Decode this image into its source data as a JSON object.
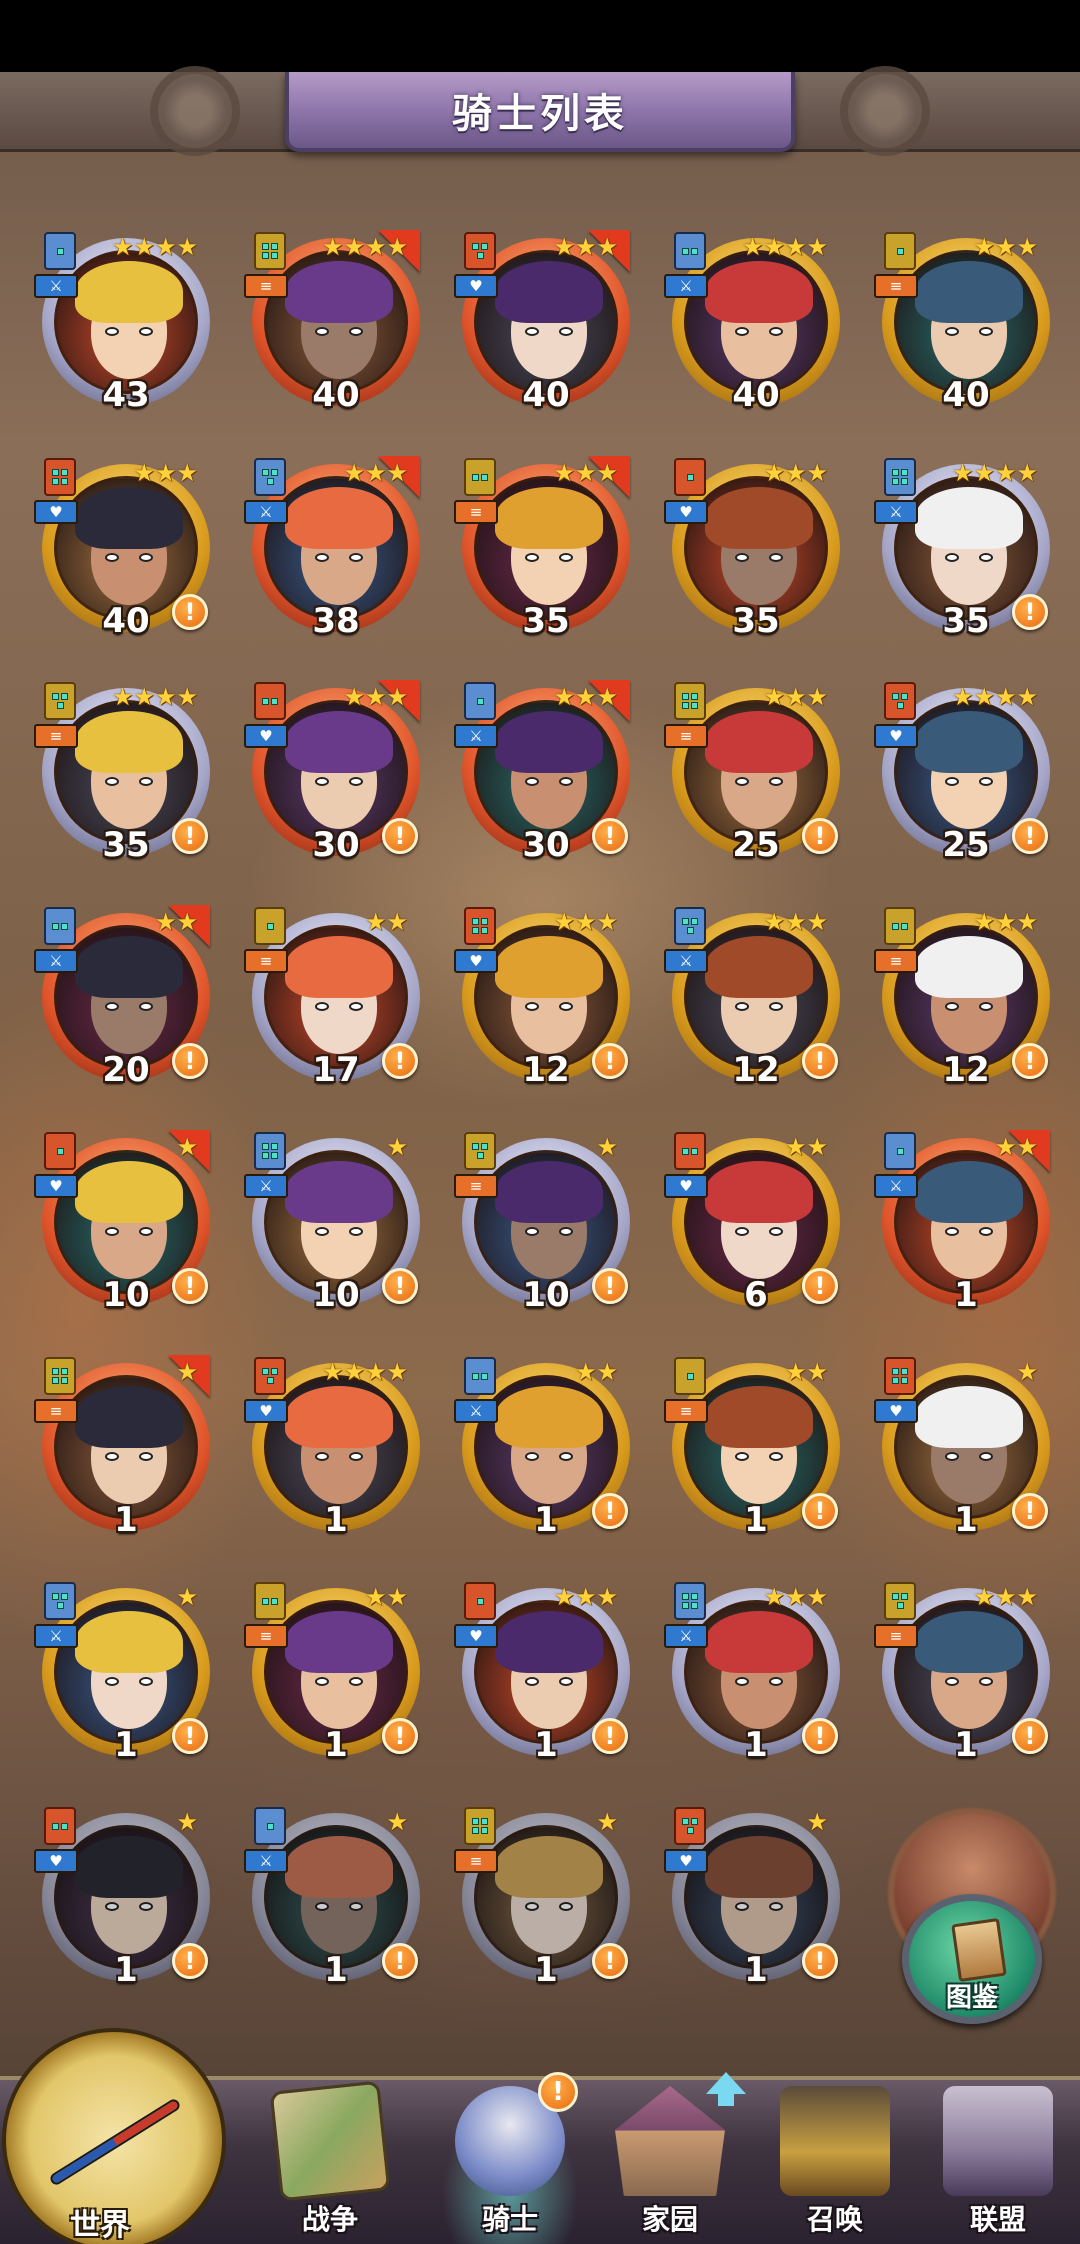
{
  "title": "骑士列表",
  "heroes": [
    {
      "level": "43",
      "stars": 4,
      "frame": "silver",
      "flag": false,
      "alert": false
    },
    {
      "level": "40",
      "stars": 4,
      "frame": "red",
      "flag": true,
      "alert": false
    },
    {
      "level": "40",
      "stars": 3,
      "frame": "red",
      "flag": true,
      "alert": false
    },
    {
      "level": "40",
      "stars": 4,
      "frame": "gold",
      "flag": false,
      "alert": false
    },
    {
      "level": "40",
      "stars": 3,
      "frame": "gold",
      "flag": false,
      "alert": false
    },
    {
      "level": "40",
      "stars": 3,
      "frame": "gold",
      "flag": false,
      "alert": true
    },
    {
      "level": "38",
      "stars": 3,
      "frame": "red",
      "flag": true,
      "alert": false
    },
    {
      "level": "35",
      "stars": 3,
      "frame": "red",
      "flag": true,
      "alert": false
    },
    {
      "level": "35",
      "stars": 3,
      "frame": "gold",
      "flag": false,
      "alert": false
    },
    {
      "level": "35",
      "stars": 4,
      "frame": "silver",
      "flag": false,
      "alert": true
    },
    {
      "level": "35",
      "stars": 4,
      "frame": "silver",
      "flag": false,
      "alert": true
    },
    {
      "level": "30",
      "stars": 3,
      "frame": "red",
      "flag": true,
      "alert": true
    },
    {
      "level": "30",
      "stars": 3,
      "frame": "red",
      "flag": true,
      "alert": true
    },
    {
      "level": "25",
      "stars": 3,
      "frame": "gold",
      "flag": false,
      "alert": true
    },
    {
      "level": "25",
      "stars": 4,
      "frame": "silver",
      "flag": false,
      "alert": true
    },
    {
      "level": "20",
      "stars": 2,
      "frame": "red",
      "flag": true,
      "alert": true
    },
    {
      "level": "17",
      "stars": 2,
      "frame": "silver",
      "flag": false,
      "alert": true
    },
    {
      "level": "12",
      "stars": 3,
      "frame": "gold",
      "flag": false,
      "alert": true
    },
    {
      "level": "12",
      "stars": 3,
      "frame": "gold",
      "flag": false,
      "alert": true
    },
    {
      "level": "12",
      "stars": 3,
      "frame": "gold",
      "flag": false,
      "alert": true
    },
    {
      "level": "10",
      "stars": 1,
      "frame": "red",
      "flag": true,
      "alert": true
    },
    {
      "level": "10",
      "stars": 1,
      "frame": "silver",
      "flag": false,
      "alert": true
    },
    {
      "level": "10",
      "stars": 1,
      "frame": "silver",
      "flag": false,
      "alert": true
    },
    {
      "level": "6",
      "stars": 2,
      "frame": "gold",
      "flag": false,
      "alert": true
    },
    {
      "level": "1",
      "stars": 2,
      "frame": "red",
      "flag": true,
      "alert": false
    },
    {
      "level": "1",
      "stars": 1,
      "frame": "red",
      "flag": true,
      "alert": false
    },
    {
      "level": "1",
      "stars": 4,
      "frame": "gold",
      "flag": false,
      "alert": false
    },
    {
      "level": "1",
      "stars": 2,
      "frame": "gold",
      "flag": false,
      "alert": true
    },
    {
      "level": "1",
      "stars": 2,
      "frame": "gold",
      "flag": false,
      "alert": true
    },
    {
      "level": "1",
      "stars": 1,
      "frame": "gold",
      "flag": false,
      "alert": true
    },
    {
      "level": "1",
      "stars": 1,
      "frame": "gold",
      "flag": false,
      "alert": true
    },
    {
      "level": "1",
      "stars": 2,
      "frame": "gold",
      "flag": false,
      "alert": true
    },
    {
      "level": "1",
      "stars": 3,
      "frame": "silver",
      "flag": false,
      "alert": true
    },
    {
      "level": "1",
      "stars": 3,
      "frame": "silver",
      "flag": false,
      "alert": true
    },
    {
      "level": "1",
      "stars": 3,
      "frame": "silver",
      "flag": false,
      "alert": true
    },
    {
      "level": "1",
      "stars": 1,
      "frame": "silver",
      "flag": false,
      "alert": true,
      "dim": true
    },
    {
      "level": "1",
      "stars": 1,
      "frame": "silver",
      "flag": false,
      "alert": true,
      "dim": true
    },
    {
      "level": "1",
      "stars": 1,
      "frame": "silver",
      "flag": false,
      "alert": true,
      "dim": true
    },
    {
      "level": "1",
      "stars": 1,
      "frame": "silver",
      "flag": false,
      "alert": true,
      "dim": true
    }
  ],
  "alert_symbol": "!",
  "codex_label": "图鉴",
  "nav": {
    "world": "世界",
    "war": "战争",
    "knight": "骑士",
    "home": "家园",
    "summon": "召唤",
    "alliance": "联盟",
    "knight_alert": "!"
  },
  "colors": {
    "gold_frame": "#d89a1c",
    "silver_frame": "#a6a7c8",
    "red_frame": "#e0542a",
    "alert": "#e86a10",
    "title_banner": "#8b73a8"
  }
}
